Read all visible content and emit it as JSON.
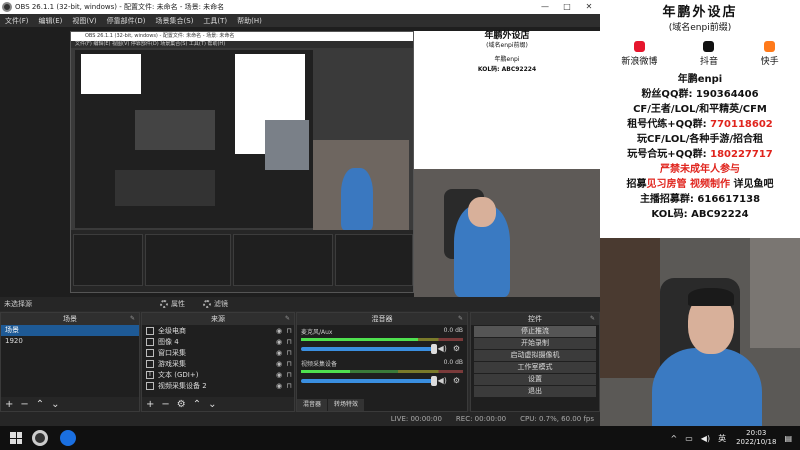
{
  "window": {
    "title": "OBS 26.1.1 (32-bit, windows) - 配置文件: 未命名 - 场景: 未命名",
    "minimize": "—",
    "maximize": "□",
    "close": "✕"
  },
  "menu": [
    "文件(F)",
    "编辑(E)",
    "视图(V)",
    "停靠部件(D)",
    "场景集合(S)",
    "工具(T)",
    "帮助(H)"
  ],
  "nested": {
    "title": "OBS 26.1.1 (32-bit, windows) - 配置文件: 未命名 - 场景: 未命名",
    "menu": "文件(F)  编辑(E)  视图(V)  停靠部件(D)  场景集合(S)  工具(T)  帮助(H)",
    "time": "20:03",
    "date": "2022/10/18"
  },
  "sourcebar": {
    "no_source": "未选择源",
    "properties": "属性",
    "filters": "滤镜"
  },
  "scenes": {
    "header": "场景",
    "items": [
      "场景",
      "1920"
    ]
  },
  "sources": {
    "header": "来源",
    "items": [
      {
        "icon": "monitor-icon",
        "label": "全级电商"
      },
      {
        "icon": "image-icon",
        "label": "图像 4"
      },
      {
        "icon": "window-icon",
        "label": "窗口采集"
      },
      {
        "icon": "gamepad-icon",
        "label": "游戏采集"
      },
      {
        "icon": "text-icon",
        "label": "文本 (GDI+)"
      },
      {
        "icon": "camera-icon",
        "label": "视频采集设备 2"
      }
    ]
  },
  "mixer": {
    "header": "混音器",
    "tracks": [
      {
        "name": "麦克风/Aux",
        "db": "0.0 dB",
        "level": 0.72
      },
      {
        "name": "视频采集设备",
        "db": "0.0 dB",
        "level": 0.3
      }
    ],
    "tabs": [
      "混音器",
      "转场特效"
    ]
  },
  "controls": {
    "header": "控件",
    "buttons": [
      "停止推流",
      "开始录制",
      "启动虚拟摄像机",
      "工作室模式",
      "设置",
      "退出"
    ]
  },
  "status": {
    "live": "LIVE: 00:00:00",
    "rec": "REC: 00:00:00",
    "cpu": "CPU: 0.7%, 60.00 fps"
  },
  "taskbar": {
    "time": "20:03",
    "date": "2022/10/18",
    "lang": "英"
  },
  "banner": {
    "title": "年鹏外设店",
    "subtitle": "(域名enpi前缀)",
    "socials": [
      {
        "label": "新浪微博",
        "color": "#e6162d"
      },
      {
        "label": "抖音",
        "color": "#111111"
      },
      {
        "label": "快手",
        "color": "#ff7a1a"
      }
    ],
    "account": "年鹏enpi",
    "lines": [
      {
        "text": "粉丝QQ群: ",
        "red": "",
        "tail": "190364406"
      },
      {
        "text": "CF/王者/LOL/和平精英/CFM",
        "red": "",
        "tail": ""
      },
      {
        "text": "租号代练+QQ群: ",
        "red": "770118602",
        "tail": ""
      },
      {
        "text": "玩CF/LOL/各种手游/招合租",
        "red": "",
        "tail": ""
      },
      {
        "text": "玩号合玩+QQ群: ",
        "red": "180227717",
        "tail": ""
      },
      {
        "text": "",
        "red": "严禁未成年人参与",
        "tail": ""
      },
      {
        "text": "招募",
        "red": "见习房管 视频制作",
        "tail": " 详见鱼吧"
      },
      {
        "text": "主播招募群: 616617138",
        "red": "",
        "tail": ""
      },
      {
        "text": "KOL码: ABC92224",
        "red": "",
        "tail": ""
      }
    ]
  }
}
